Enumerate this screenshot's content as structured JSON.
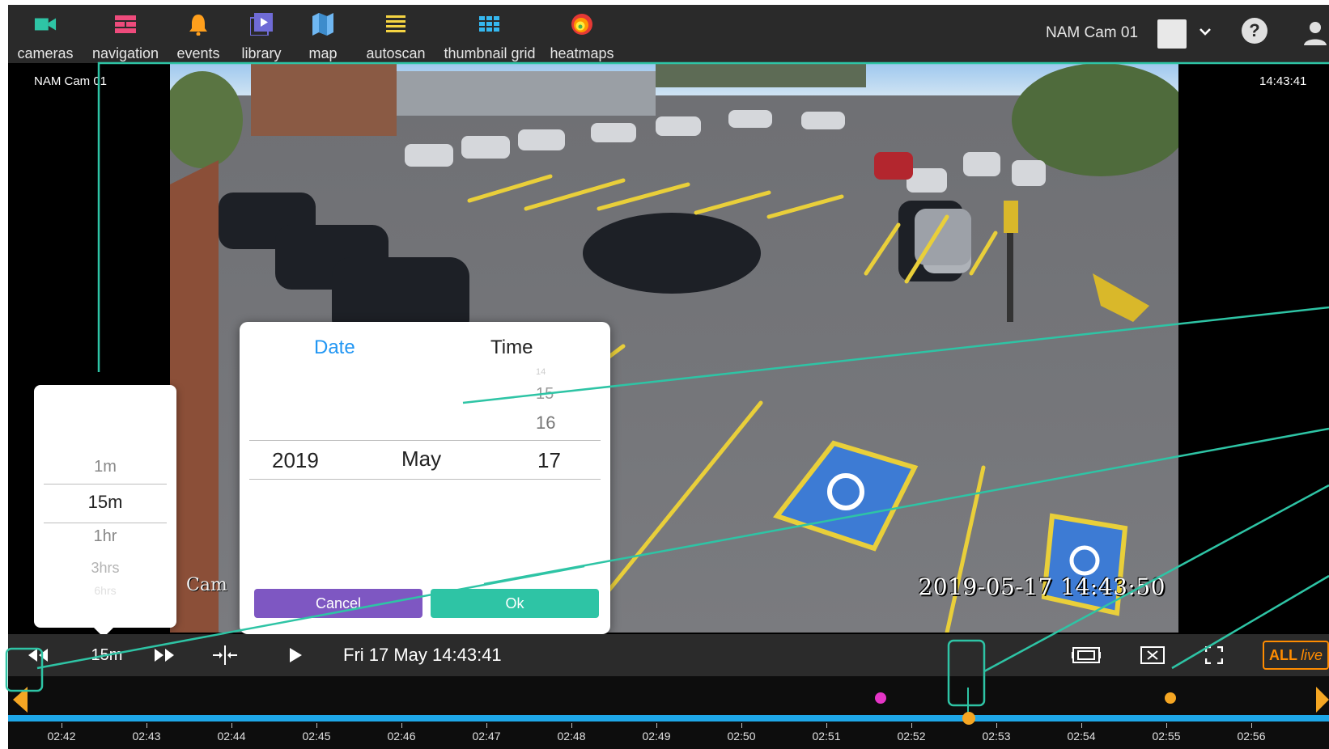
{
  "nav": [
    {
      "label": "cameras",
      "icon": "camera-icon",
      "color": "#2ec4a5"
    },
    {
      "label": "navigation",
      "icon": "grid-layout-icon",
      "color": "#ee4b7c"
    },
    {
      "label": "events",
      "icon": "bell-icon",
      "color": "#ff9f1c"
    },
    {
      "label": "library",
      "icon": "video-library-icon",
      "color": "#6f6bd6"
    },
    {
      "label": "map",
      "icon": "map-icon",
      "color": "#6fb7f2"
    },
    {
      "label": "autoscan",
      "icon": "list-icon",
      "color": "#f5d442"
    },
    {
      "label": "thumbnail grid",
      "icon": "thumbnail-grid-icon",
      "color": "#35b8f0"
    },
    {
      "label": "heatmaps",
      "icon": "heatmap-icon",
      "color": "#e53935"
    }
  ],
  "header": {
    "camera_name": "NAM Cam 01",
    "help_label": "?"
  },
  "viewport": {
    "camera_label": "NAM Cam 01",
    "time": "14:43:41",
    "osd_timestamp": "2019-05-17 14:43:50",
    "osd_camera": "Cam"
  },
  "zoom_picker": {
    "options": [
      "1m",
      "15m",
      "1hr",
      "3hrs",
      "6hrs"
    ],
    "selected": "15m"
  },
  "datetime_dialog": {
    "tab_date": "Date",
    "tab_time": "Time",
    "wheel_above": [
      "14",
      "15",
      "16"
    ],
    "year": "2019",
    "month": "May",
    "day": "17",
    "cancel_label": "Cancel",
    "ok_label": "Ok"
  },
  "controls": {
    "zoom_value": "15m",
    "date_display": "Fri 17 May  14:43:41",
    "live_all": "ALL",
    "live_label": "live"
  },
  "timeline": {
    "ticks": [
      "02:42",
      "02:43",
      "02:44",
      "02:45",
      "02:46",
      "02:47",
      "02:48",
      "02:49",
      "02:50",
      "02:51",
      "02:52",
      "02:53",
      "02:54",
      "02:55",
      "02:56"
    ],
    "track_color": "#1ea7e8",
    "event_colors": [
      "#e535c6",
      "#f5a623"
    ]
  },
  "colors": {
    "accent": "#2ec4a5",
    "date_tab": "#2196f3",
    "cancel": "#7e57c2",
    "live": "#ff8c00"
  }
}
